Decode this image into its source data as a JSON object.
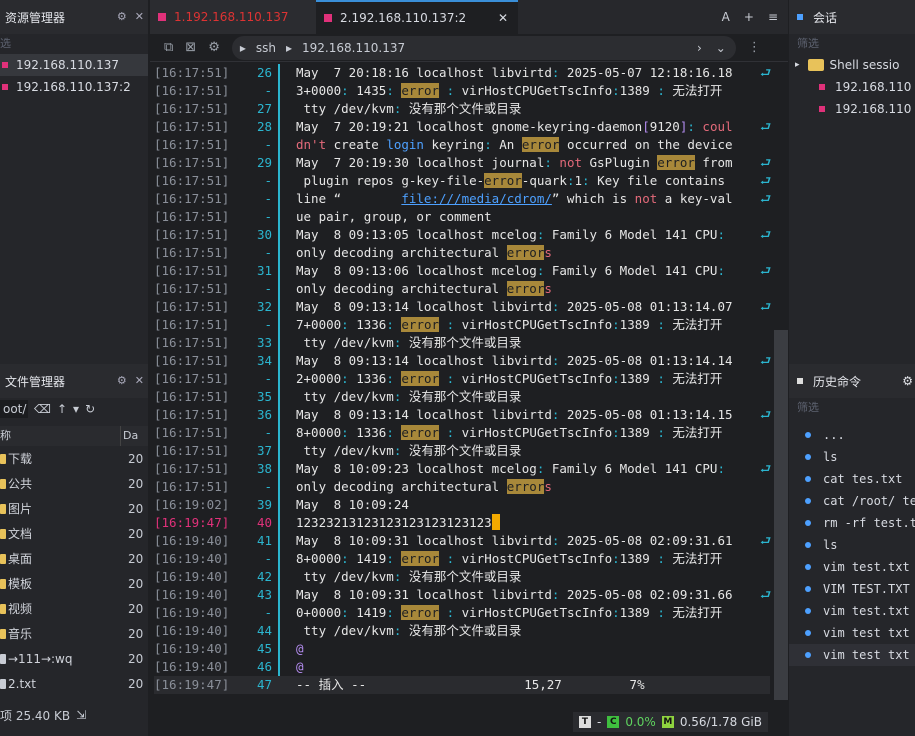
{
  "left": {
    "resource_title": "资源管理器",
    "filter_placeholder": "选",
    "sessions": [
      {
        "label": "192.168.110.137",
        "selected": true
      },
      {
        "label": "192.168.110.137:2",
        "selected": false
      }
    ],
    "file_title": "文件管理器",
    "path_value": "oot/",
    "column_name": "称",
    "column_date": "Da",
    "files": [
      {
        "name": "下载",
        "date": "20",
        "kind": "folder"
      },
      {
        "name": "公共",
        "date": "20",
        "kind": "folder"
      },
      {
        "name": "图片",
        "date": "20",
        "kind": "folder"
      },
      {
        "name": "文档",
        "date": "20",
        "kind": "folder"
      },
      {
        "name": "桌面",
        "date": "20",
        "kind": "folder"
      },
      {
        "name": "模板",
        "date": "20",
        "kind": "folder"
      },
      {
        "name": "视频",
        "date": "20",
        "kind": "folder"
      },
      {
        "name": "音乐",
        "date": "20",
        "kind": "folder"
      },
      {
        "name": "→111→:wq",
        "date": "20",
        "kind": "file"
      },
      {
        "name": "2.txt",
        "date": "20",
        "kind": "file"
      }
    ],
    "status_text": "项 25.40 KB"
  },
  "tabs": [
    {
      "label": "1.192.168.110.137",
      "active": false
    },
    {
      "label": "2.192.168.110.137:2",
      "active": true
    }
  ],
  "tab_controls": {
    "font": "A",
    "add": "+",
    "menu": "≡"
  },
  "toolbar": {
    "protocol": "ssh",
    "host": "192.168.110.137"
  },
  "terminal": {
    "lines": [
      {
        "ts": "[16:17:51]",
        "no": "26",
        "html": "May  7 20:18:16 localhost libvirtd<span class='cyn'>:</span> 2025-05-07 12:18:16.18",
        "wrap": true
      },
      {
        "ts": "[16:17:51]",
        "no": "-",
        "html": "3+0000<span class='cyn'>:</span> 1435<span class='cyn'>:</span> <span class='err'>error</span> <span class='cyn'>:</span> virHostCPUGetTscInfo<span class='cyn'>:</span>1389 <span class='cyn'>:</span> 无法打开"
      },
      {
        "ts": "[16:17:51]",
        "no": "27",
        "html": " tty /dev/kvm<span class='cyn'>:</span> 没有那个文件或目录"
      },
      {
        "ts": "[16:17:51]",
        "no": "28",
        "html": "May  7 20:19:21 localhost gnome-keyring-daemon<span class='vio'>[</span>9120<span class='vio'>]</span><span class='cyn'>:</span> <span class='hot'>coul</span>",
        "wrap": true
      },
      {
        "ts": "[16:17:51]",
        "no": "-",
        "html": "<span class='hot'>dn't</span> create <span class='blu'>login</span> keyring<span class='cyn'>:</span> An <span class='err'>error</span> occurred on the device"
      },
      {
        "ts": "[16:17:51]",
        "no": "29",
        "html": "May  7 20:19:30 localhost journal<span class='cyn'>:</span> <span class='hot'>not</span> GsPlugin <span class='err'>error</span> from",
        "wrap": true
      },
      {
        "ts": "[16:17:51]",
        "no": "-",
        "html": " plugin repos g-key-file-<span class='err'>error</span>-quark<span class='cyn'>:</span>1<span class='cyn'>:</span> Key file contains ",
        "wrap": true
      },
      {
        "ts": "[16:17:51]",
        "no": "-",
        "html": "line “        <span class='lnk'>file:///media/cdrom/</span>” which is <span class='hot'>not</span> a key-val",
        "wrap": true
      },
      {
        "ts": "[16:17:51]",
        "no": "-",
        "html": "ue pair, group, or comment"
      },
      {
        "ts": "[16:17:51]",
        "no": "30",
        "html": "May  8 09:13:05 localhost mcelog<span class='cyn'>:</span> Family 6 Model 141 CPU<span class='cyn'>:</span> ",
        "wrap": true
      },
      {
        "ts": "[16:17:51]",
        "no": "-",
        "html": "only decoding architectural <span class='err'>error</span><span class='hot'>s</span>"
      },
      {
        "ts": "[16:17:51]",
        "no": "31",
        "html": "May  8 09:13:06 localhost mcelog<span class='cyn'>:</span> Family 6 Model 141 CPU<span class='cyn'>:</span> ",
        "wrap": true
      },
      {
        "ts": "[16:17:51]",
        "no": "-",
        "html": "only decoding architectural <span class='err'>error</span><span class='hot'>s</span>"
      },
      {
        "ts": "[16:17:51]",
        "no": "32",
        "html": "May  8 09:13:14 localhost libvirtd<span class='cyn'>:</span> 2025-05-08 01:13:14.07",
        "wrap": true
      },
      {
        "ts": "[16:17:51]",
        "no": "-",
        "html": "7+0000<span class='cyn'>:</span> 1336<span class='cyn'>:</span> <span class='err'>error</span> <span class='cyn'>:</span> virHostCPUGetTscInfo<span class='cyn'>:</span>1389 <span class='cyn'>:</span> 无法打开"
      },
      {
        "ts": "[16:17:51]",
        "no": "33",
        "html": " tty /dev/kvm<span class='cyn'>:</span> 没有那个文件或目录"
      },
      {
        "ts": "[16:17:51]",
        "no": "34",
        "html": "May  8 09:13:14 localhost libvirtd<span class='cyn'>:</span> 2025-05-08 01:13:14.14",
        "wrap": true
      },
      {
        "ts": "[16:17:51]",
        "no": "-",
        "html": "2+0000<span class='cyn'>:</span> 1336<span class='cyn'>:</span> <span class='err'>error</span> <span class='cyn'>:</span> virHostCPUGetTscInfo<span class='cyn'>:</span>1389 <span class='cyn'>:</span> 无法打开"
      },
      {
        "ts": "[16:17:51]",
        "no": "35",
        "html": " tty /dev/kvm<span class='cyn'>:</span> 没有那个文件或目录"
      },
      {
        "ts": "[16:17:51]",
        "no": "36",
        "html": "May  8 09:13:14 localhost libvirtd<span class='cyn'>:</span> 2025-05-08 01:13:14.15",
        "wrap": true
      },
      {
        "ts": "[16:17:51]",
        "no": "-",
        "html": "8+0000<span class='cyn'>:</span> 1336<span class='cyn'>:</span> <span class='err'>error</span> <span class='cyn'>:</span> virHostCPUGetTscInfo<span class='cyn'>:</span>1389 <span class='cyn'>:</span> 无法打开"
      },
      {
        "ts": "[16:17:51]",
        "no": "37",
        "html": " tty /dev/kvm<span class='cyn'>:</span> 没有那个文件或目录"
      },
      {
        "ts": "[16:17:51]",
        "no": "38",
        "html": "May  8 10:09:23 localhost mcelog<span class='cyn'>:</span> Family 6 Model 141 CPU<span class='cyn'>:</span> ",
        "wrap": true
      },
      {
        "ts": "[16:17:51]",
        "no": "-",
        "html": "only decoding architectural <span class='err'>error</span><span class='hot'>s</span>"
      },
      {
        "ts": "[16:19:02]",
        "no": "39",
        "html": "May  8 10:09:24"
      },
      {
        "ts": "[16:19:47]",
        "no": "40",
        "html": "1232321312312312312312<span class='hot'></span>3123<span class='cur'></span>",
        "hl": true
      },
      {
        "ts": "[16:19:40]",
        "no": "41",
        "html": "May  8 10:09:31 localhost libvirtd<span class='cyn'>:</span> 2025-05-08 02:09:31.61",
        "wrap": true
      },
      {
        "ts": "[16:19:40]",
        "no": "-",
        "html": "8+0000<span class='cyn'>:</span> 1419<span class='cyn'>:</span> <span class='err'>error</span> <span class='cyn'>:</span> virHostCPUGetTscInfo<span class='cyn'>:</span>1389 <span class='cyn'>:</span> 无法打开"
      },
      {
        "ts": "[16:19:40]",
        "no": "42",
        "html": " tty /dev/kvm<span class='cyn'>:</span> 没有那个文件或目录"
      },
      {
        "ts": "[16:19:40]",
        "no": "43",
        "html": "May  8 10:09:31 localhost libvirtd<span class='cyn'>:</span> 2025-05-08 02:09:31.66",
        "wrap": true
      },
      {
        "ts": "[16:19:40]",
        "no": "-",
        "html": "0+0000<span class='cyn'>:</span> 1419<span class='cyn'>:</span> <span class='err'>error</span> <span class='cyn'>:</span> virHostCPUGetTscInfo<span class='cyn'>:</span>1389 <span class='cyn'>:</span> 无法打开"
      },
      {
        "ts": "[16:19:40]",
        "no": "44",
        "html": " tty /dev/kvm<span class='cyn'>:</span> 没有那个文件或目录"
      },
      {
        "ts": "[16:19:40]",
        "no": "45",
        "html": "<span class='vio'>@</span>"
      },
      {
        "ts": "[16:19:40]",
        "no": "46",
        "html": "<span class='vio'>@</span>"
      },
      {
        "ts": "[16:19:47]",
        "no": "47",
        "html": "-- 插入 --                     15,27         7%",
        "status": true
      }
    ],
    "wrap_glyph": "⮐"
  },
  "status": {
    "t_label": "T",
    "dash": "-",
    "cpu_label": "C",
    "cpu_value": "0.0%",
    "mem_label": "M",
    "mem_value": "0.56/1.78 GiB"
  },
  "right": {
    "session_title": "会话",
    "filter_placeholder": "筛选",
    "tree": [
      {
        "label": "Shell sessio",
        "kind": "folder"
      },
      {
        "label": "192.168.110",
        "kind": "session"
      },
      {
        "label": "192.168.110",
        "kind": "session"
      }
    ],
    "history_title": "历史命令",
    "history_filter": "筛选",
    "history": [
      "...",
      "ls",
      "cat tes.txt",
      "cat /root/ tes",
      "rm -rf test.tx",
      "ls",
      "vim test.txt",
      "VIM TEST.TXT",
      "vim test.txt",
      "vim test txt",
      "vim test txt"
    ]
  }
}
